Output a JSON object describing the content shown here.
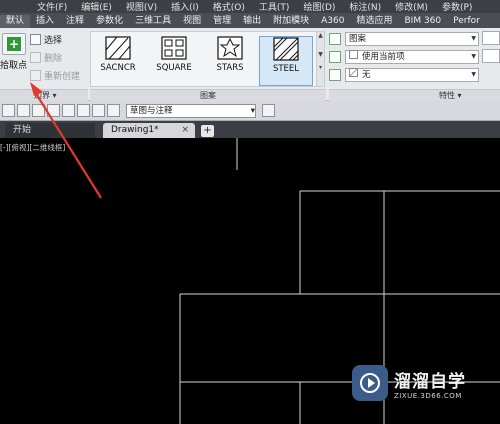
{
  "menubar": {
    "items": [
      "文件(F)",
      "编辑(E)",
      "视图(V)",
      "插入(I)",
      "格式(O)",
      "工具(T)",
      "绘图(D)",
      "标注(N)",
      "修改(M)",
      "参数(P)"
    ]
  },
  "ribbon_tabs": [
    "默认",
    "插入",
    "注释",
    "参数化",
    "三维工具",
    "视图",
    "管理",
    "输出",
    "附加模块",
    "A360",
    "精选应用",
    "BIM 360",
    "Perfor"
  ],
  "boundary_panel": {
    "pick_points": "拾取点",
    "select": "选择",
    "remove": "删除",
    "recreate": "重新创建",
    "footer": "边界"
  },
  "pattern_panel": {
    "patterns": [
      "SACNCR",
      "SQUARE",
      "STARS",
      "STEEL"
    ],
    "selected": "STEEL",
    "footer": "图案"
  },
  "properties_panel": {
    "type_value": "图案",
    "color_value": "使用当前项",
    "background_value": "无",
    "footer": "特性"
  },
  "quick_access": {
    "workspace": "草图与注释"
  },
  "file_tabs": {
    "start": "开始",
    "drawing": "Drawing1*",
    "close_glyph": "×",
    "new_tab": "+"
  },
  "viewport": {
    "label": "[-][俯视][二维线框]"
  },
  "watermark": {
    "title": "溜溜自学",
    "subtitle": "ZIXUE.3D66.COM"
  },
  "colors": {
    "menubar_bg": "#3d3f45",
    "ribbon_bg": "#e8e9ec",
    "canvas_bg": "#000000",
    "drawing_lines": "#d8d8d8",
    "arrow": "#e03a2e"
  }
}
